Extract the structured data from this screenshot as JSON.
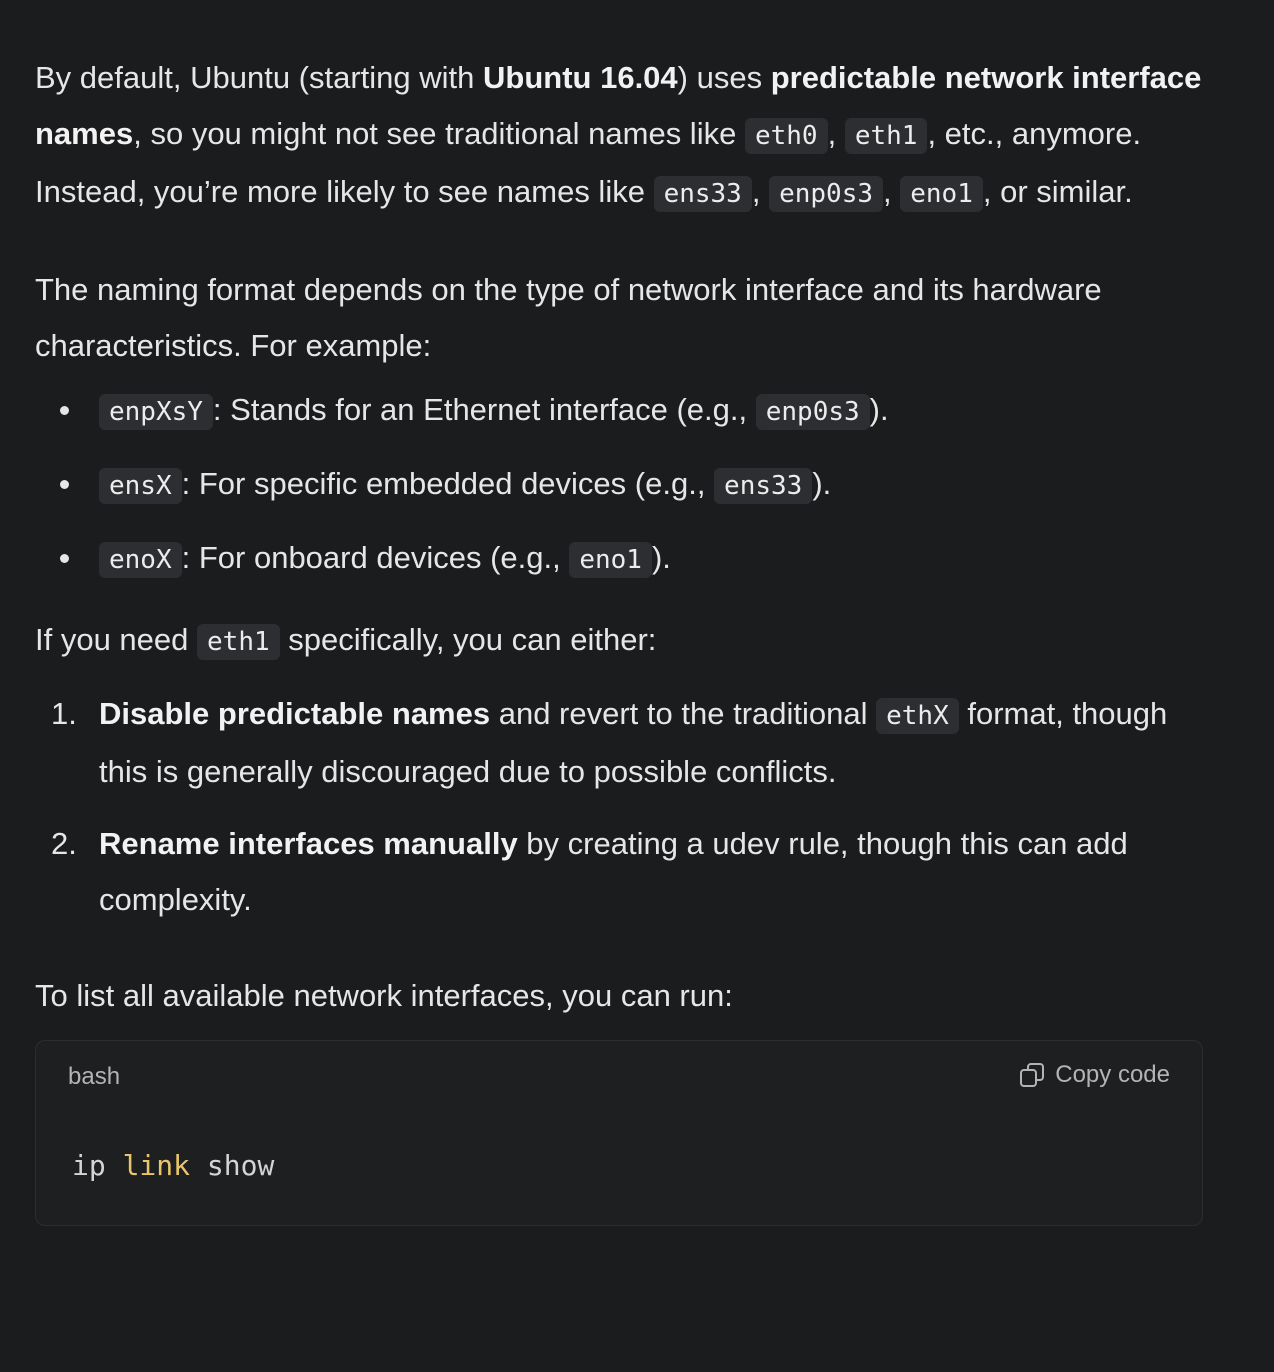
{
  "para1": {
    "t1": "By default, Ubuntu (starting with ",
    "b1": "Ubuntu 16.04",
    "t2": ") uses ",
    "b2": "predictable network interface names",
    "t3": ", so you might not see traditional names like ",
    "c1": "eth0",
    "t4": ", ",
    "c2": "eth1",
    "t5": ", etc., anymore. Instead, you’re more likely to see names like ",
    "c3": "ens33",
    "t6": ", ",
    "c4": "enp0s3",
    "t7": ", ",
    "c5": "eno1",
    "t8": ", or similar."
  },
  "para2": "The naming format depends on the type of network interface and its hardware characteristics. For example:",
  "bullets": [
    {
      "code": "enpXsY",
      "text": ": Stands for an Ethernet interface (e.g., ",
      "example": "enp0s3",
      "end": ")."
    },
    {
      "code": "ensX",
      "text": ": For specific embedded devices (e.g., ",
      "example": "ens33",
      "end": ")."
    },
    {
      "code": "enoX",
      "text": ": For onboard devices (e.g., ",
      "example": "eno1",
      "end": ")."
    }
  ],
  "para3": {
    "t1": "If you need ",
    "c1": "eth1",
    "t2": " specifically, you can either:"
  },
  "steps": [
    {
      "num": "1.",
      "bold": "Disable predictable names",
      "t1": " and revert to the traditional ",
      "code": "ethX",
      "t2": " format, though this is generally discouraged due to possible conflicts."
    },
    {
      "num": "2.",
      "bold": "Rename interfaces manually",
      "t1": " by creating a udev rule, though this can add complexity."
    }
  ],
  "para4": "To list all available network interfaces, you can run:",
  "codeblock": {
    "language": "bash",
    "copy_label": "Copy code",
    "copy_icon": "copy-icon",
    "tokens": [
      "ip",
      " ",
      "link",
      " ",
      "show"
    ]
  },
  "colors": {
    "background": "#1b1c1e",
    "inline_code_bg": "#2d2e31",
    "keyword": "#e9c46a"
  }
}
